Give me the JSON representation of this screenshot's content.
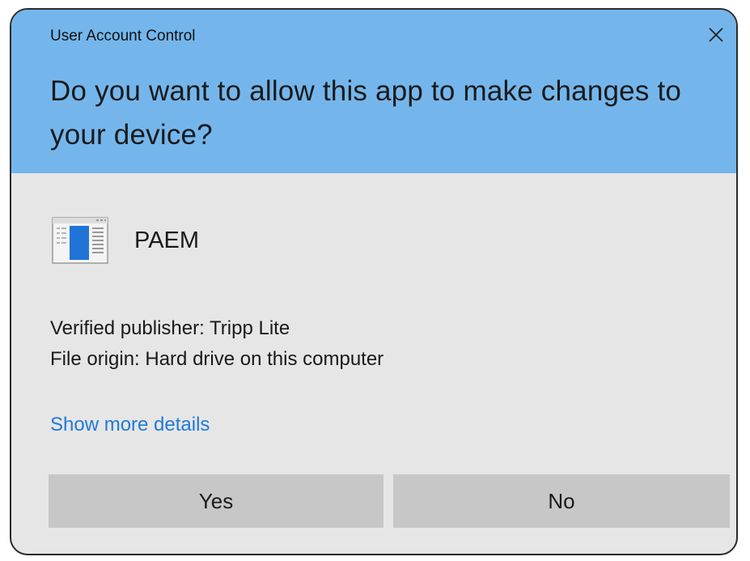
{
  "dialog": {
    "window_title": "User Account Control",
    "question": "Do you want to allow this app to make changes to your device?",
    "close_icon": "close-icon",
    "header_color": "#74b6ec",
    "body_color": "#e6e6e6"
  },
  "app": {
    "icon": "application-window-icon",
    "name": "PAEM"
  },
  "info": {
    "publisher": "Verified publisher: Tripp Lite",
    "origin": "File origin: Hard drive on this computer"
  },
  "details_link": {
    "label": "Show more details",
    "color": "#1f7ad8"
  },
  "buttons": {
    "yes_label": "Yes",
    "no_label": "No",
    "color": "#c7c7c7"
  }
}
